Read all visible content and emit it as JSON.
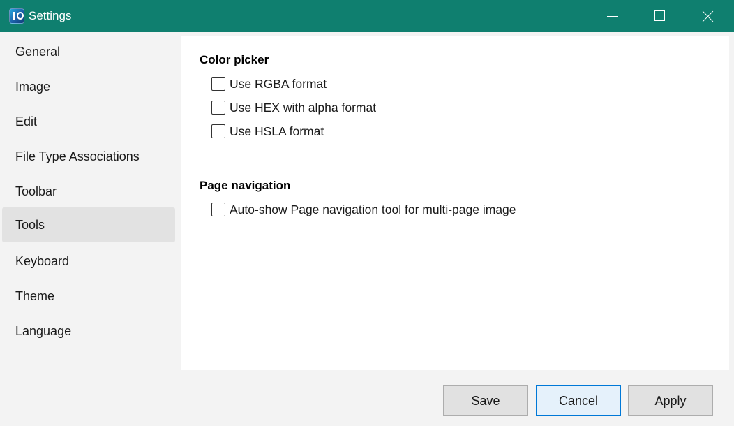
{
  "window": {
    "title": "Settings",
    "icon": "imageglass-app-icon",
    "controls": [
      "minimize-icon",
      "maximize-icon",
      "close-icon"
    ],
    "accent_color": "#0f7f6f"
  },
  "sidebar": {
    "selected": "Tools",
    "items": [
      {
        "label": "General"
      },
      {
        "label": "Image"
      },
      {
        "label": "Edit"
      },
      {
        "label": "File Type Associations"
      },
      {
        "label": "Toolbar"
      },
      {
        "label": "Tools"
      },
      {
        "label": "Keyboard"
      },
      {
        "label": "Theme"
      },
      {
        "label": "Language"
      }
    ]
  },
  "content": {
    "color_picker": {
      "title": "Color picker",
      "options": [
        {
          "label": "Use RGBA format",
          "checked": false
        },
        {
          "label": "Use HEX with alpha format",
          "checked": false
        },
        {
          "label": "Use HSLA format",
          "checked": false
        }
      ]
    },
    "page_navigation": {
      "title": "Page navigation",
      "options": [
        {
          "label": "Auto-show Page navigation tool for multi-page image",
          "checked": false
        }
      ]
    }
  },
  "footer": {
    "save_label": "Save",
    "cancel_label": "Cancel",
    "apply_label": "Apply",
    "focused_button": "Cancel"
  }
}
